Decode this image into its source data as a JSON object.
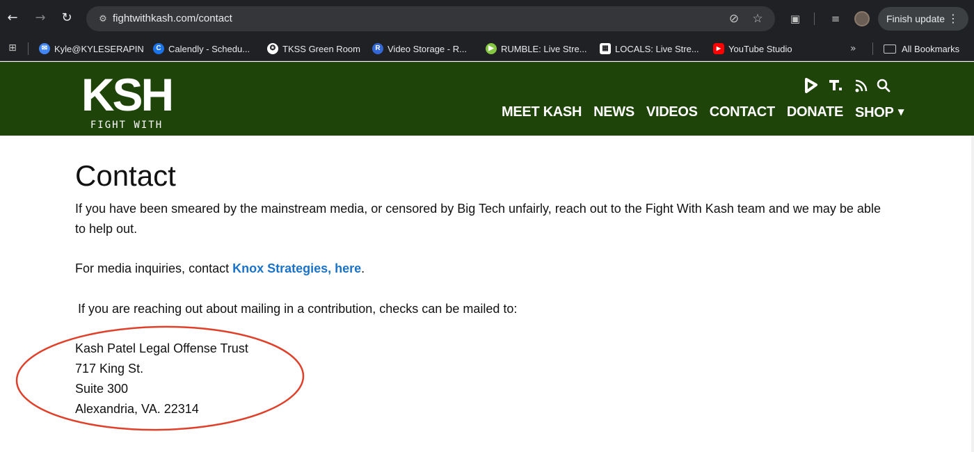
{
  "browser": {
    "url": "fightwithkash.com/contact",
    "finish_update_label": "Finish update",
    "icons": {
      "back": "arrow-left-icon",
      "forward": "arrow-right-icon",
      "reload": "reload-icon",
      "site_info": "tune-icon",
      "eye_off": "eye-off-icon",
      "bookmark_star": "star-icon",
      "tab_search": "tab-search-icon",
      "media": "media-queue-icon",
      "menu": "kebab-menu-icon"
    },
    "bookmarks": [
      {
        "label": "Kyle@KYLESERAPIN",
        "color": "#4285f4",
        "glyph": "✉"
      },
      {
        "label": "Calendly - Schedu...",
        "color": "#1a73e8",
        "glyph": "C"
      },
      {
        "label": "TKSS Green Room",
        "color": "#ffffff",
        "glyph": "✪"
      },
      {
        "label": "Video Storage - R...",
        "color": "#3367d6",
        "glyph": "R"
      },
      {
        "label": "RUMBLE: Live Stre...",
        "color": "#85c742",
        "glyph": "▶"
      },
      {
        "label": "LOCALS: Live Stre...",
        "color": "#ffffff",
        "glyph": "▦"
      },
      {
        "label": "YouTube Studio",
        "color": "#ff0000",
        "glyph": "▶"
      }
    ],
    "more_bookmarks": "»",
    "all_bookmarks_label": "All Bookmarks"
  },
  "site": {
    "logo_letters": "KSH",
    "logo_tagline": "FIGHT WITH KASH",
    "header_icons": [
      "rumble-icon",
      "truth-social-icon",
      "rss-icon",
      "search-icon"
    ],
    "nav": [
      "MEET KASH",
      "NEWS",
      "VIDEOS",
      "CONTACT",
      "DONATE",
      "SHOP"
    ],
    "brand_color": "#1e4409",
    "link_color": "#1a73c8"
  },
  "content": {
    "title": "Contact",
    "paragraph1": "If you have been smeared by the mainstream media, or censored by Big Tech unfairly, reach out to the Fight With Kash team and we may be able to help out.",
    "media_prefix": "For media inquiries, contact ",
    "media_link": "Knox Strategies, here",
    "media_suffix": ".",
    "paragraph3": "If you are reaching out about mailing in a contribution, checks can be mailed to:",
    "address": [
      "Kash Patel Legal Offense Trust",
      "717 King St.",
      "Suite 300",
      "Alexandria, VA. 22314"
    ],
    "annotation_color": "#e0402a"
  }
}
